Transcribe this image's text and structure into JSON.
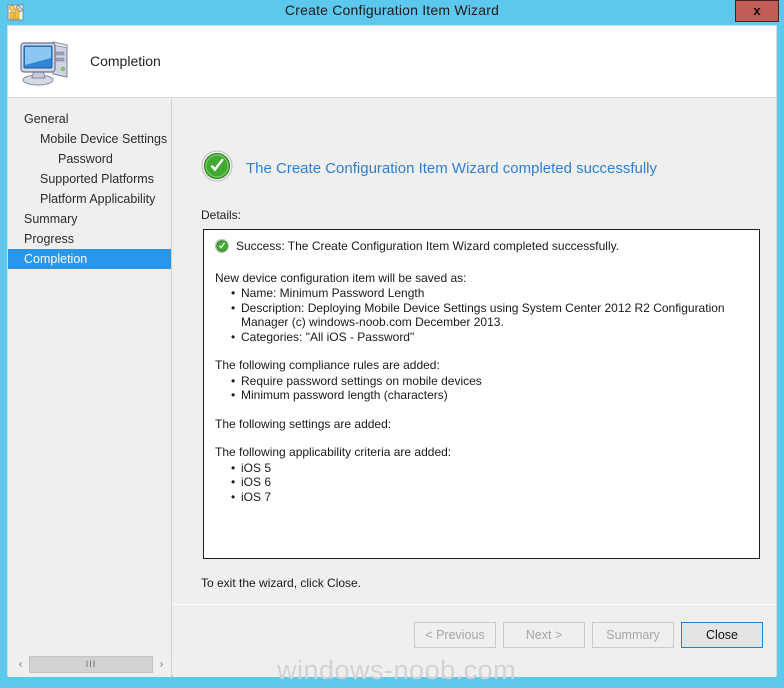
{
  "window": {
    "title": "Create Configuration Item Wizard",
    "icon": "wizard-config-item-icon",
    "close_label": "x"
  },
  "banner": {
    "icon": "computer-monitor-icon",
    "title": "Completion"
  },
  "sidebar": {
    "items": [
      {
        "label": "General",
        "level": 0,
        "selected": false
      },
      {
        "label": "Mobile Device Settings",
        "level": 1,
        "selected": false
      },
      {
        "label": "Password",
        "level": 2,
        "selected": false
      },
      {
        "label": "Supported Platforms",
        "level": 1,
        "selected": false
      },
      {
        "label": "Platform Applicability",
        "level": 1,
        "selected": false
      },
      {
        "label": "Summary",
        "level": 0,
        "selected": false
      },
      {
        "label": "Progress",
        "level": 0,
        "selected": false
      },
      {
        "label": "Completion",
        "level": 0,
        "selected": true
      }
    ],
    "scrollbar": {
      "left_arrow": "‹",
      "right_arrow": "›",
      "thumb_grip": "III"
    }
  },
  "main": {
    "result_icon": "success-check-icon",
    "result_title": "The Create Configuration Item Wizard completed successfully",
    "details_label": "Details:",
    "details": {
      "success_icon": "success-check-small-icon",
      "success_line": "Success: The Create Configuration Item Wizard completed successfully.",
      "blocks": [
        {
          "heading": "New device configuration item will be saved as:",
          "items": [
            "Name: Minimum Password Length",
            "Description: Deploying Mobile Device Settings using System Center 2012 R2 Configuration Manager (c) windows-noob.com December 2013.",
            "Categories: \"All iOS - Password\""
          ]
        },
        {
          "heading": "The following compliance rules are added:",
          "items": [
            "Require password settings on mobile devices",
            "Minimum password length (characters)"
          ]
        },
        {
          "heading": "The following settings are added:",
          "items": []
        },
        {
          "heading": "The following applicability criteria are added:",
          "items": [
            "iOS 5",
            "iOS 6",
            "iOS 7"
          ]
        }
      ]
    },
    "exit_note": "To exit the wizard, click Close."
  },
  "footer": {
    "previous_label": "< Previous",
    "next_label": "Next >",
    "summary_label": "Summary",
    "close_label": "Close"
  },
  "watermark": "windows-noob.com",
  "colors": {
    "title_bar": "#5cc8ee",
    "close_button": "#c35b56",
    "selection": "#2a96ea",
    "link_heading": "#2f7fd0",
    "success_green": "#3aaa35",
    "client_bg": "#efefef"
  }
}
